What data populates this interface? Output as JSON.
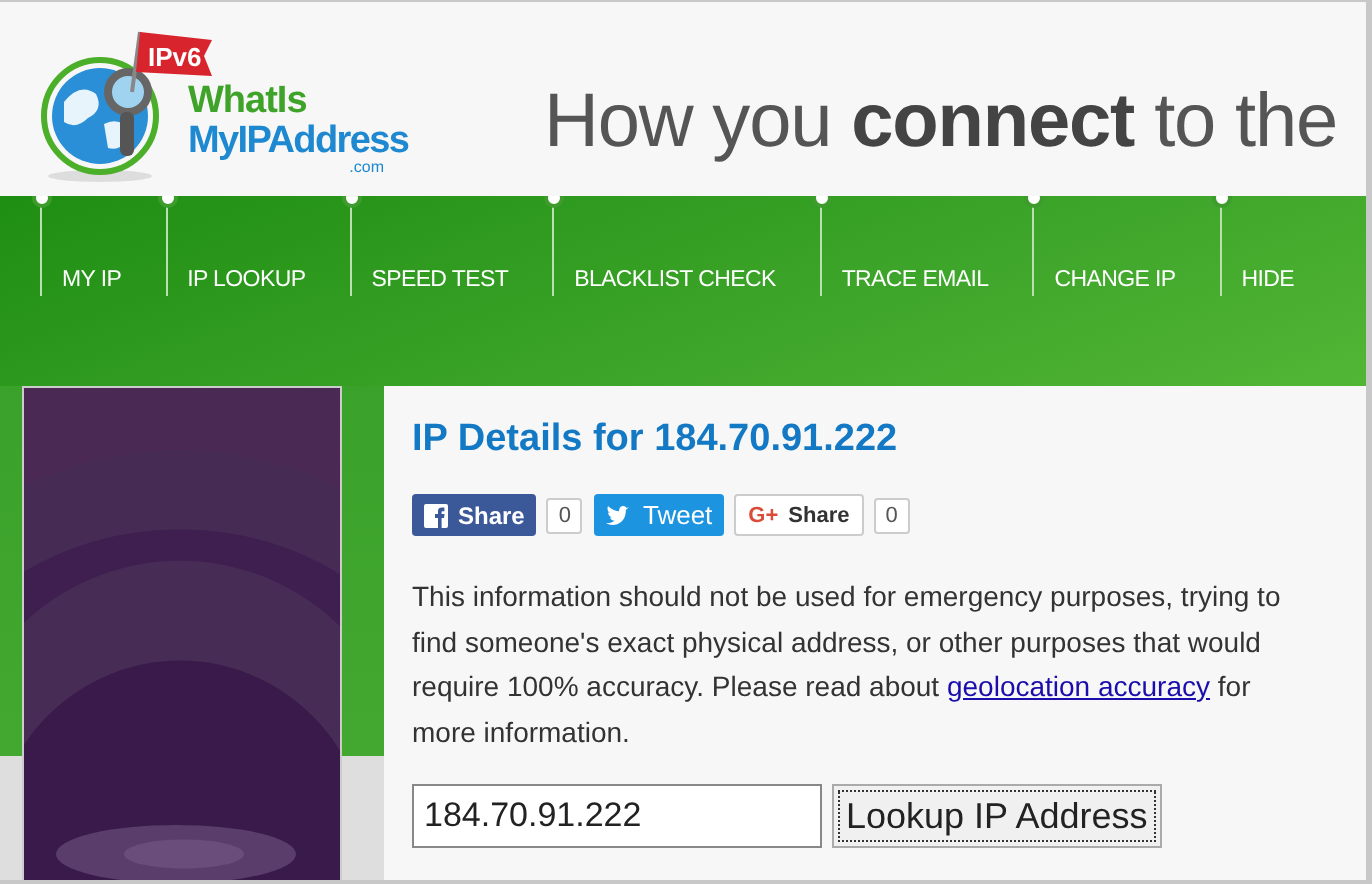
{
  "logo": {
    "flag": "IPv6",
    "line1": "WhatIs",
    "line2": "MyIPAddress",
    "domain": ".com"
  },
  "tagline": "How you **connect** to the",
  "nav": [
    "MY IP",
    "IP LOOKUP",
    "SPEED TEST",
    "BLACKLIST CHECK",
    "TRACE EMAIL",
    "CHANGE IP",
    "HIDE"
  ],
  "heading": "IP Details for 184.70.91.222",
  "share": [
    {
      "kind": "facebook",
      "label": "Share",
      "count": "0"
    },
    {
      "kind": "twitter",
      "label": "Tweet"
    },
    {
      "kind": "google",
      "icon": "G+",
      "label": "Share",
      "count": "0"
    }
  ],
  "notice": {
    "before": "This information should not be used for emergency purposes, trying to find someone's exact physical address, or other purposes that would require 100% accuracy. Please read about",
    "link": "geolocation accuracy",
    "after": "for more information."
  },
  "lookup": {
    "value": "184.70.91.222",
    "button": "Lookup IP Address"
  }
}
